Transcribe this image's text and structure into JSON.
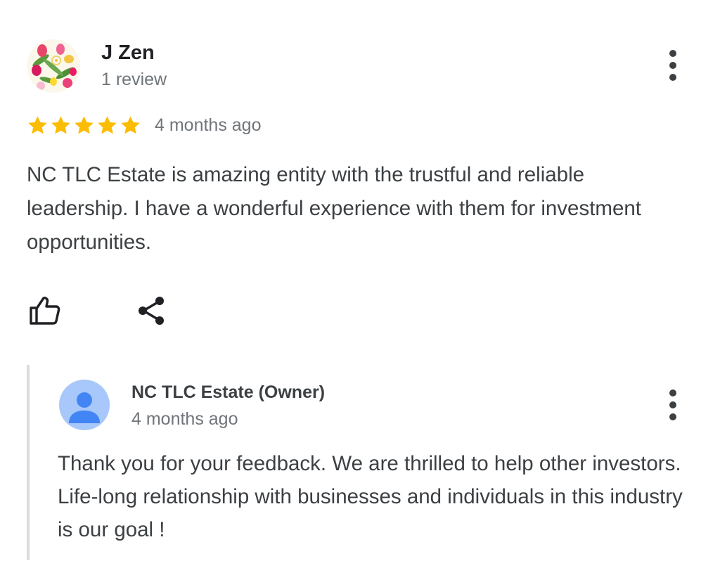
{
  "review": {
    "author_name": "J Zen",
    "author_meta": "1 review",
    "rating": 5,
    "rating_max": 5,
    "time_ago": "4 months ago",
    "text": "NC TLC Estate is amazing entity with the trustful and reliable leadership. I have a wonderful experience with them for investment opportunities."
  },
  "owner_reply": {
    "author_name": "NC TLC Estate (Owner)",
    "time_ago": "4 months ago",
    "text": "Thank you for your feedback. We are thrilled to help other investors. Life-long relationship with businesses and individuals in this industry is our goal !"
  },
  "icons": {
    "like": "thumb-up-outline-icon",
    "share": "share-icon",
    "menu": "more-vert-icon",
    "star": "star-filled-icon",
    "user_avatar": "flower-bouquet-avatar",
    "owner_avatar": "default-person-avatar"
  },
  "colors": {
    "star": "#fbbc04",
    "text_primary": "#202124",
    "text_body": "#3c4043",
    "text_secondary": "#70757a",
    "reply_bar": "#dadce0",
    "owner_avatar_bg": "#a8c7fa",
    "owner_avatar_fg": "#4285f4"
  }
}
